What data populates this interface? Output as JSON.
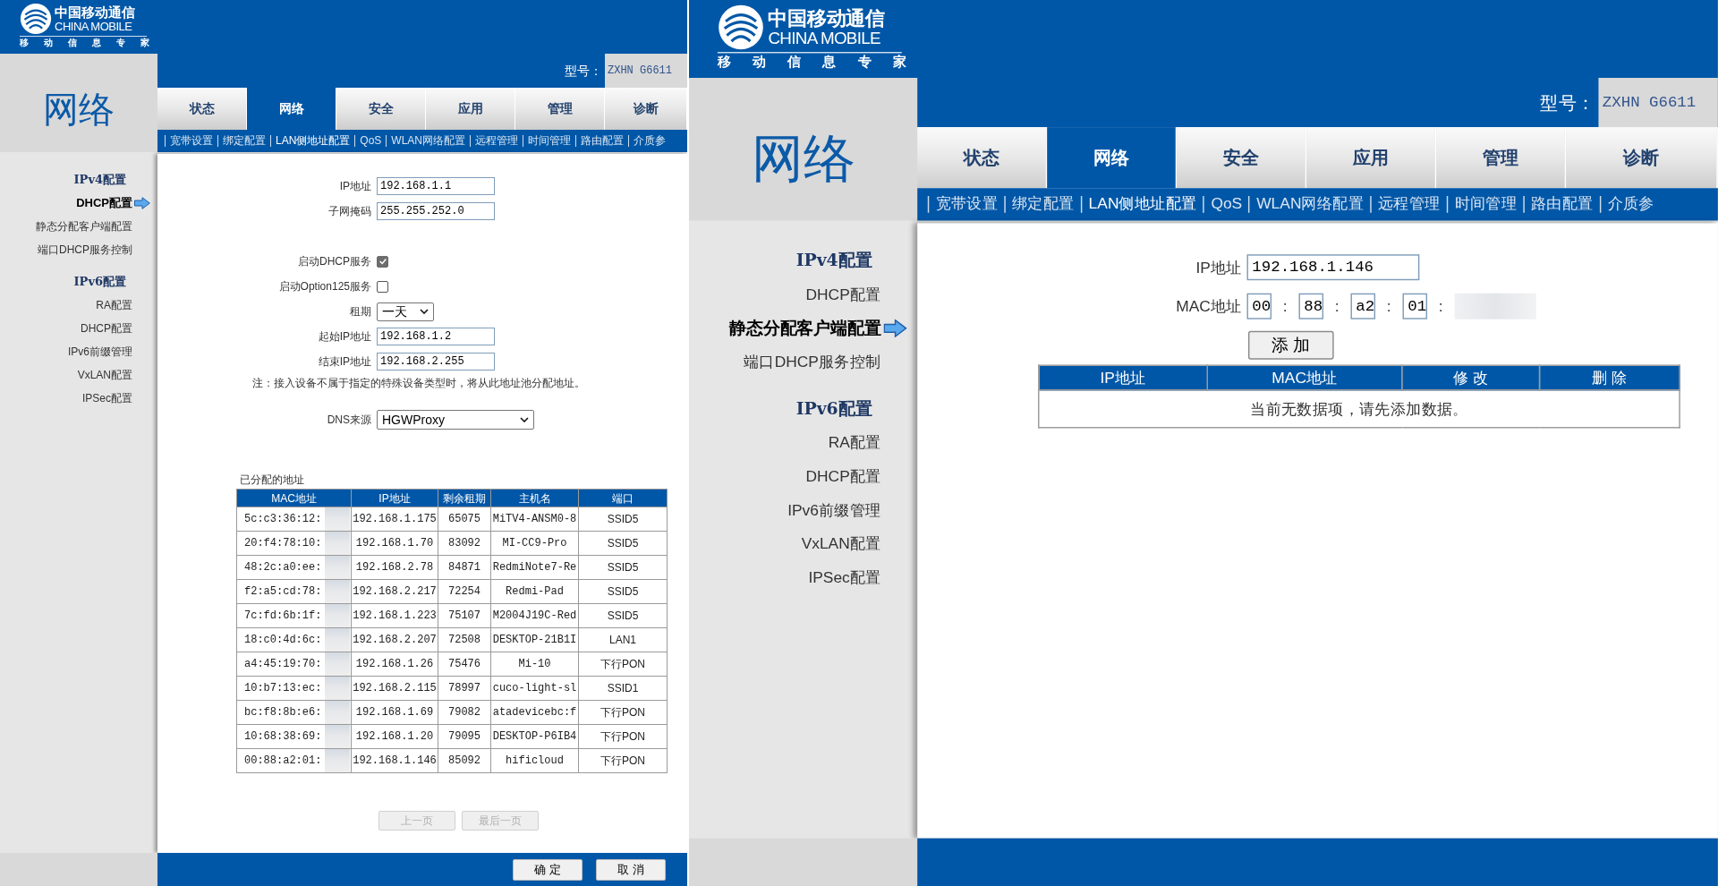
{
  "panels": [
    {
      "kind": "dhcp",
      "header": {
        "brand_cn": "中国移动通信",
        "brand_en": "CHINA MOBILE",
        "slogan": "移动信息专家"
      },
      "model_label": "型号：",
      "model": "ZXHN G6611",
      "section_title": "网络",
      "tabs": [
        {
          "label": "状态",
          "selected": false
        },
        {
          "label": "网络",
          "selected": true
        },
        {
          "label": "安全",
          "selected": false
        },
        {
          "label": "应用",
          "selected": false
        },
        {
          "label": "管理",
          "selected": false
        },
        {
          "label": "诊断",
          "selected": false
        }
      ],
      "subnav": [
        {
          "label": "宽带设置",
          "selected": false
        },
        {
          "label": "绑定配置",
          "selected": false
        },
        {
          "label": "LAN侧地址配置",
          "selected": true
        },
        {
          "label": "QoS",
          "selected": false
        },
        {
          "label": "WLAN网络配置",
          "selected": false
        },
        {
          "label": "远程管理",
          "selected": false
        },
        {
          "label": "时间管理",
          "selected": false
        },
        {
          "label": "路由配置",
          "selected": false
        },
        {
          "label": "介质参",
          "selected": false
        }
      ],
      "sidebar": [
        {
          "title": "IPv4配置",
          "items": [
            {
              "label": "DHCP配置",
              "selected": true
            },
            {
              "label": "静态分配客户端配置",
              "selected": false
            },
            {
              "label": "端口DHCP服务控制",
              "selected": false
            }
          ]
        },
        {
          "title": "IPv6配置",
          "items": [
            {
              "label": "RA配置",
              "selected": false
            },
            {
              "label": "DHCP配置",
              "selected": false
            },
            {
              "label": "IPv6前缀管理",
              "selected": false
            },
            {
              "label": "VxLAN配置",
              "selected": false
            },
            {
              "label": "IPSec配置",
              "selected": false
            }
          ]
        }
      ],
      "form_sections": [
        {
          "rows": [
            {
              "kind": "text",
              "label": "IP地址",
              "value": "192.168.1.1"
            },
            {
              "kind": "text",
              "label": "子网掩码",
              "value": "255.255.252.0"
            }
          ]
        },
        {
          "rows": [
            {
              "kind": "checkbox",
              "label": "启动DHCP服务",
              "checked": true
            },
            {
              "kind": "checkbox",
              "label": "启动Option125服务",
              "checked": false
            },
            {
              "kind": "select",
              "label": "租期",
              "value": "一天"
            },
            {
              "kind": "text",
              "label": "起始IP地址",
              "value": "192.168.1.2"
            },
            {
              "kind": "text",
              "label": "结束IP地址",
              "value": "192.168.2.255"
            }
          ],
          "note": "注：接入设备不属于指定的特殊设备类型时，将从此地址池分配地址。"
        },
        {
          "rows": [
            {
              "kind": "select_wide",
              "label": "DNS来源",
              "value": "HGWProxy"
            }
          ]
        }
      ],
      "table": {
        "caption": "已分配的地址",
        "mac_redacted": true,
        "columns": [
          "MAC地址",
          "IP地址",
          "剩余租期",
          "主机名",
          "端口"
        ],
        "rows": [
          [
            "5c:c3:36:12:",
            "192.168.1.175",
            "65075",
            "MiTV4-ANSM0-8",
            "SSID5"
          ],
          [
            "20:f4:78:10:",
            "192.168.1.70",
            "83092",
            "MI-CC9-Pro",
            "SSID5"
          ],
          [
            "48:2c:a0:ee:",
            "192.168.2.78",
            "84871",
            "RedmiNote7-Re",
            "SSID5"
          ],
          [
            "f2:a5:cd:78:",
            "192.168.2.217",
            "72254",
            "Redmi-Pad",
            "SSID5"
          ],
          [
            "7c:fd:6b:1f:",
            "192.168.1.223",
            "75107",
            "M2004J19C-Red",
            "SSID5"
          ],
          [
            "18:c0:4d:6c:",
            "192.168.2.207",
            "72508",
            "DESKTOP-21B1I",
            "LAN1"
          ],
          [
            "a4:45:19:70:",
            "192.168.1.26",
            "75476",
            "Mi-10",
            "下行PON"
          ],
          [
            "10:b7:13:ec:",
            "192.168.2.115",
            "78997",
            "cuco-light-sl",
            "SSID1"
          ],
          [
            "bc:f8:8b:e6:",
            "192.168.1.69",
            "79082",
            "atadevicebc:f",
            "下行PON"
          ],
          [
            "10:68:38:69:",
            "192.168.1.20",
            "79095",
            "DESKTOP-P6IB4",
            "下行PON"
          ],
          [
            "00:88:a2:01:",
            "192.168.1.146",
            "85092",
            "hificloud",
            "下行PON"
          ]
        ]
      },
      "pager": [
        {
          "label": "上一页",
          "disabled": true
        },
        {
          "label": "最后一页",
          "disabled": true
        }
      ],
      "footer_buttons": [
        "确 定",
        "取 消"
      ]
    },
    {
      "kind": "static",
      "header": {
        "brand_cn": "中国移动通信",
        "brand_en": "CHINA MOBILE",
        "slogan": "移动信息专家"
      },
      "model_label": "型号：",
      "model": "ZXHN G6611",
      "section_title": "网络",
      "tabs": [
        {
          "label": "状态",
          "selected": false
        },
        {
          "label": "网络",
          "selected": true
        },
        {
          "label": "安全",
          "selected": false
        },
        {
          "label": "应用",
          "selected": false
        },
        {
          "label": "管理",
          "selected": false
        },
        {
          "label": "诊断",
          "selected": false
        }
      ],
      "subnav": [
        {
          "label": "宽带设置",
          "selected": false
        },
        {
          "label": "绑定配置",
          "selected": false
        },
        {
          "label": "LAN侧地址配置",
          "selected": true
        },
        {
          "label": "QoS",
          "selected": false
        },
        {
          "label": "WLAN网络配置",
          "selected": false
        },
        {
          "label": "远程管理",
          "selected": false
        },
        {
          "label": "时间管理",
          "selected": false
        },
        {
          "label": "路由配置",
          "selected": false
        },
        {
          "label": "介质参",
          "selected": false
        }
      ],
      "sidebar": [
        {
          "title": "IPv4配置",
          "items": [
            {
              "label": "DHCP配置",
              "selected": false
            },
            {
              "label": "静态分配客户端配置",
              "selected": true
            },
            {
              "label": "端口DHCP服务控制",
              "selected": false
            }
          ]
        },
        {
          "title": "IPv6配置",
          "items": [
            {
              "label": "RA配置",
              "selected": false
            },
            {
              "label": "DHCP配置",
              "selected": false
            },
            {
              "label": "IPv6前缀管理",
              "selected": false
            },
            {
              "label": "VxLAN配置",
              "selected": false
            },
            {
              "label": "IPSec配置",
              "selected": false
            }
          ]
        }
      ],
      "static_form": {
        "ip": {
          "label": "IP地址",
          "value": "192.168.1.146"
        },
        "mac": {
          "label": "MAC地址",
          "separator": ":",
          "octets": [
            "00",
            "88",
            "a2",
            "01"
          ],
          "redacted": true
        }
      },
      "add_button": "添 加",
      "static_table": {
        "columns": [
          "IP地址",
          "MAC地址",
          "修 改",
          "删 除"
        ],
        "empty_message": "当前无数据项，请先添加数据。"
      }
    }
  ]
}
